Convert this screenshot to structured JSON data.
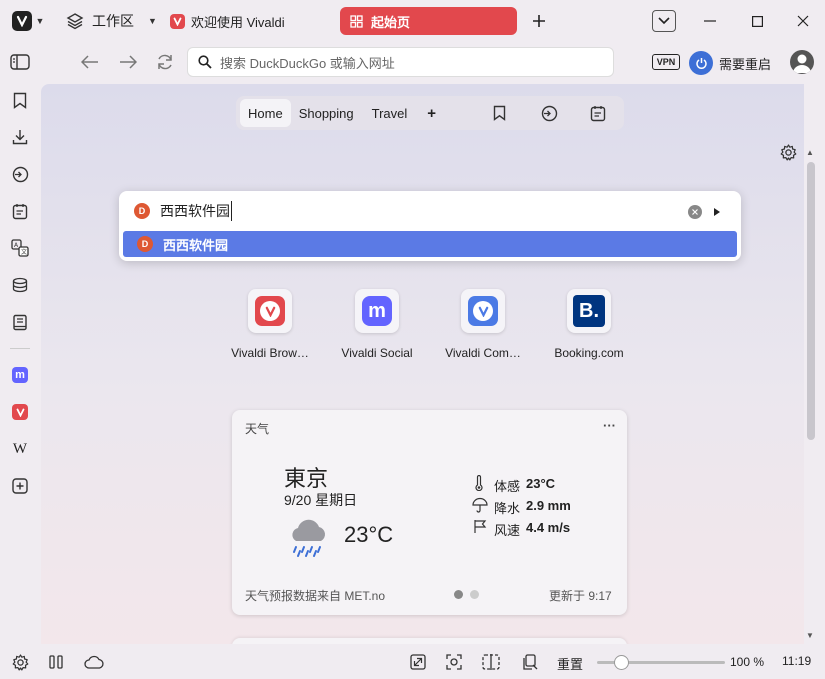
{
  "tabbar": {
    "workspace_label": "工作区",
    "tab_welcome_title": "欢迎使用 Vivaldi",
    "tab_active_title": "起始页"
  },
  "addressbar": {
    "placeholder": "搜索 DuckDuckGo 或输入网址",
    "vpn_label": "VPN",
    "restart_label": "需要重启"
  },
  "speed_dial_tabs": [
    "Home",
    "Shopping",
    "Travel",
    "+"
  ],
  "search": {
    "query": "西西软件园",
    "suggestion": "西西软件园"
  },
  "tiles": [
    {
      "label": "Vivaldi Brow…",
      "icon": "vivaldi-icon",
      "color": "#e2484d"
    },
    {
      "label": "Vivaldi Social",
      "icon": "mastodon-icon",
      "color": "#6364ff"
    },
    {
      "label": "Vivaldi Com…",
      "icon": "vivaldi-community-icon",
      "color": "#4b7ae5"
    },
    {
      "label": "Booking.com",
      "icon": "booking-icon",
      "color": "#003580"
    }
  ],
  "weather": {
    "title": "天气",
    "menu": "···",
    "city": "東京",
    "date": "9/20 星期日",
    "temp": "23°C",
    "feels_label": "体感",
    "feels_value": "23°C",
    "precip_label": "降水",
    "precip_value": "2.9 mm",
    "wind_label": "风速",
    "wind_value": "4.4 m/s",
    "source": "天气预报数据来自 MET.no",
    "updated": "更新于 9:17"
  },
  "statusbar": {
    "reset_label": "重置",
    "zoom": "100 %",
    "zoom_fraction": 0.2,
    "time": "11:19"
  }
}
